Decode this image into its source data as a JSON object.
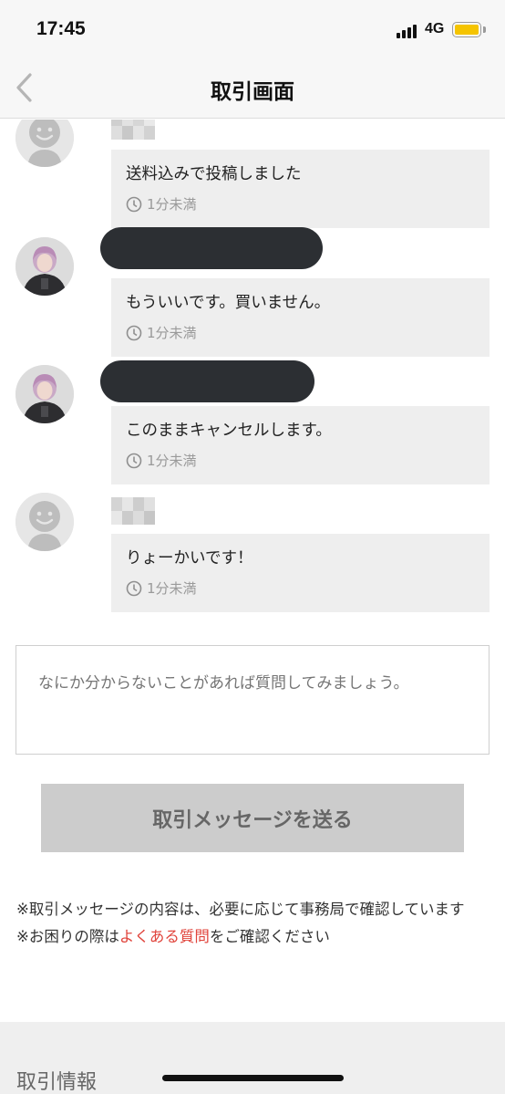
{
  "status_bar": {
    "time": "17:45",
    "network": "4G",
    "battery_color": "#f5c400"
  },
  "nav": {
    "title": "取引画面",
    "back_icon": "chevron-left-icon"
  },
  "messages": [
    {
      "sender": "other",
      "avatar": "default-face-avatar",
      "name_style": "pixelated",
      "text": "送料込みで投稿しました",
      "time": "1分未満"
    },
    {
      "sender": "self",
      "avatar": "user-photo-avatar",
      "name_style": "redacted",
      "text": "もういいです。買いません。",
      "time": "1分未満"
    },
    {
      "sender": "self",
      "avatar": "user-photo-avatar",
      "name_style": "redacted",
      "text": "このままキャンセルします。",
      "time": "1分未満"
    },
    {
      "sender": "other",
      "avatar": "default-face-avatar",
      "name_style": "pixelated",
      "text": "りょーかいです！",
      "time": "1分未満"
    }
  ],
  "input": {
    "placeholder": "なにか分からないことがあれば質問してみましょう。",
    "value": ""
  },
  "send_button": {
    "label": "取引メッセージを送る"
  },
  "notes": {
    "line1": "※取引メッセージの内容は、必要に応じて事務局で確認しています",
    "line2_prefix": "※お困りの際は",
    "line2_link": "よくある質問",
    "line2_suffix": "をご確認ください"
  },
  "section_title": "取引情報",
  "colors": {
    "accent_link": "#e0443c",
    "bubble_bg": "#eeeeee",
    "button_bg": "#cccccc"
  }
}
